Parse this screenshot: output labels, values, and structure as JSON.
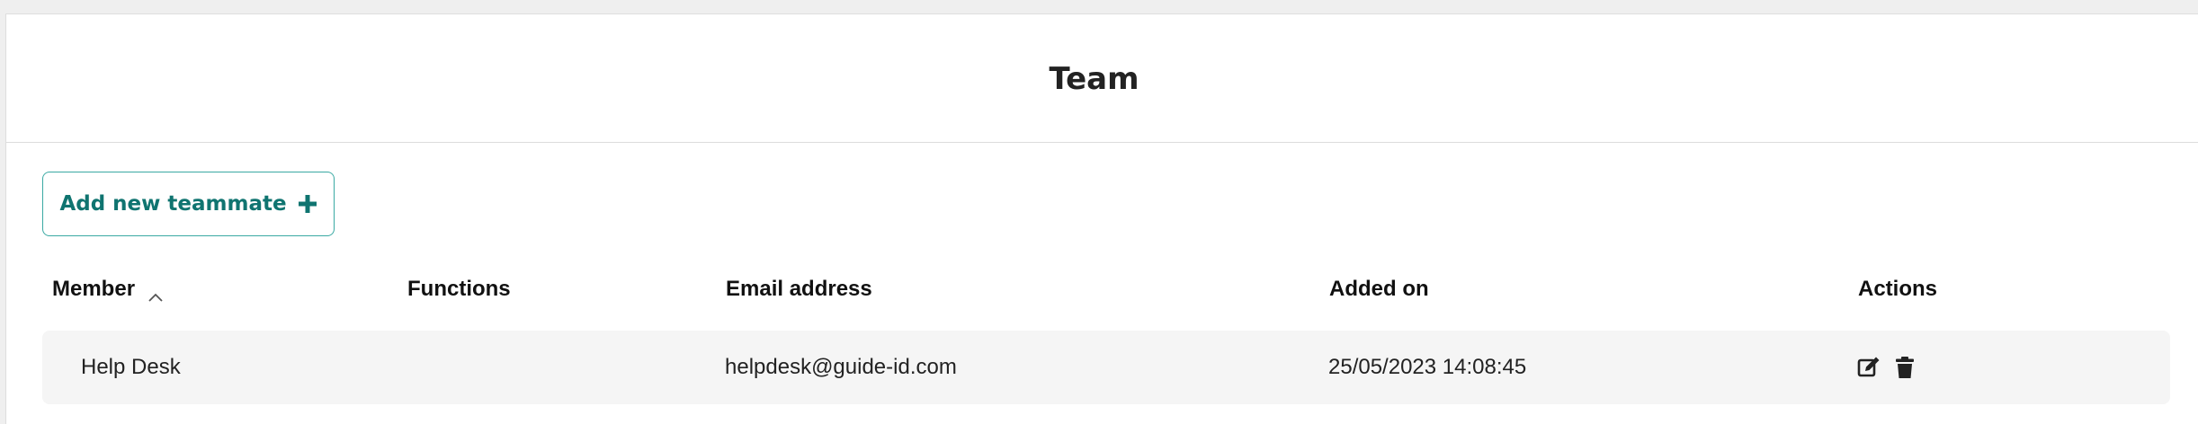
{
  "page": {
    "title": "Team"
  },
  "toolbar": {
    "add_label": "Add new teammate",
    "add_icon": "plus-icon"
  },
  "colors": {
    "accent": "#0f7470",
    "accent_border": "#3aa9a3",
    "row_bg": "#f5f5f5"
  },
  "table": {
    "columns": {
      "member": "Member",
      "functions": "Functions",
      "email": "Email address",
      "added_on": "Added on",
      "actions": "Actions"
    },
    "sort": {
      "column": "member",
      "direction": "ascending",
      "icon": "chevron-up-icon"
    },
    "rows": [
      {
        "member": "Help Desk",
        "functions": "",
        "email": "helpdesk@guide-id.com",
        "added_on": "25/05/2023 14:08:45",
        "actions": [
          "edit-icon",
          "trash-icon"
        ]
      }
    ]
  }
}
